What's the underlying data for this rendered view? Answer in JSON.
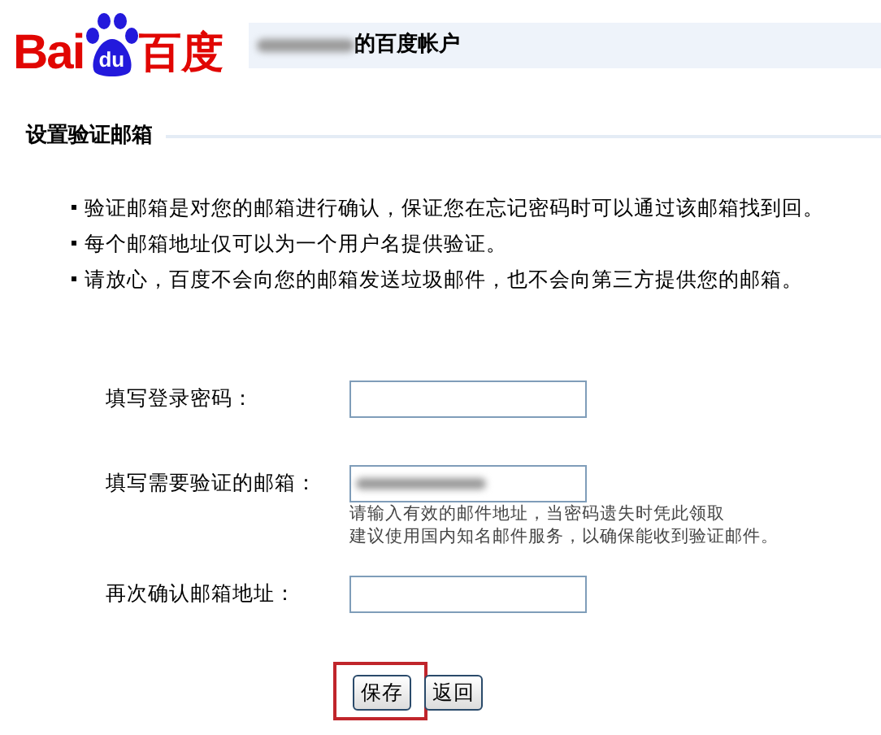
{
  "logo": {
    "left": "Bai",
    "paw": "du",
    "right": "百度"
  },
  "header": {
    "title": "的百度帐户"
  },
  "section": {
    "title": "设置验证邮箱"
  },
  "notes": [
    "验证邮箱是对您的邮箱进行确认，保证您在忘记密码时可以通过该邮箱找到回。",
    "每个邮箱地址仅可以为一个用户名提供验证。",
    "请放心，百度不会向您的邮箱发送垃圾邮件，也不会向第三方提供您的邮箱。"
  ],
  "fields": [
    {
      "label": "填写登录密码：",
      "kind": "empty"
    },
    {
      "label": "填写需要验证的邮箱：",
      "kind": "redacted",
      "hints": [
        "请输入有效的邮件地址，当密码遗失时凭此领取",
        "建议使用国内知名邮件服务，以确保能收到验证邮件。"
      ]
    },
    {
      "label": "再次确认邮箱地址：",
      "kind": "empty"
    }
  ],
  "buttons": [
    {
      "label": "保存",
      "highlighted": true
    },
    {
      "label": "返回",
      "highlighted": false
    }
  ]
}
